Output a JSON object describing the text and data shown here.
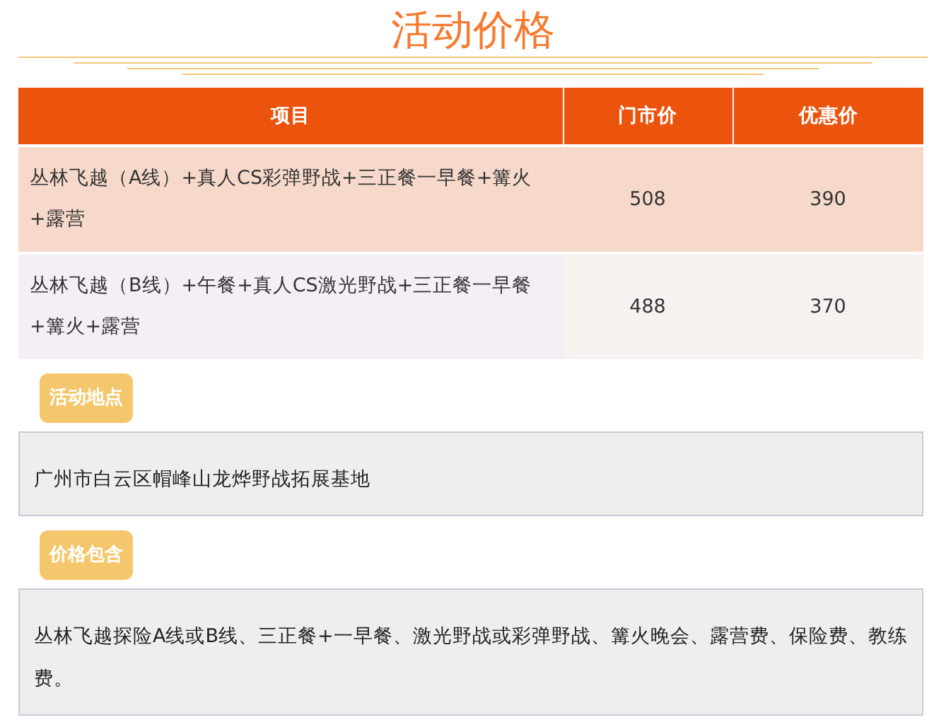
{
  "title": "活动价格",
  "table": {
    "columns": [
      "项目",
      "门市价",
      "优惠价"
    ],
    "rows": [
      {
        "item": "丛林飞越（A线）+真人CS彩弹野战+三正餐一早餐+篝火+露营",
        "list_price": "508",
        "sale_price": "390"
      },
      {
        "item": "丛林飞越（B线）+午餐+真人CS激光野战+三正餐一早餐+篝火+露营",
        "list_price": "488",
        "sale_price": "370"
      }
    ]
  },
  "sections": [
    {
      "label": "活动地点",
      "text": "广州市白云区帽峰山龙烨野战拓展基地"
    },
    {
      "label": "价格包含",
      "text": "丛林飞越探险A线或B线、三正餐+一早餐、激光野战或彩弹野战、篝火晚会、露营费、保险费、教练费。"
    }
  ]
}
